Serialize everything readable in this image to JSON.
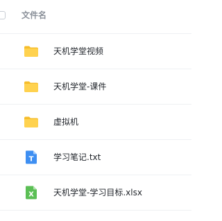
{
  "header": {
    "column_title": "文件名"
  },
  "files": [
    {
      "name": "天机学堂视频",
      "type": "folder",
      "icon": "folder-icon"
    },
    {
      "name": "天机学堂-课件",
      "type": "folder",
      "icon": "folder-icon"
    },
    {
      "name": "虚拟机",
      "type": "folder",
      "icon": "folder-icon"
    },
    {
      "name": "学习笔记.txt",
      "type": "txt",
      "icon": "text-file-icon",
      "icon_glyph": "T"
    },
    {
      "name": "天机学堂-学习目标.xlsx",
      "type": "xlsx",
      "icon": "excel-file-icon",
      "icon_glyph": "X"
    }
  ],
  "colors": {
    "folder_back": "#f6bd2b",
    "folder_front": "#ffd24f",
    "txt_icon": "#3e8ff2",
    "xlsx_icon": "#5bbf55",
    "divider": "#eef0f3"
  }
}
